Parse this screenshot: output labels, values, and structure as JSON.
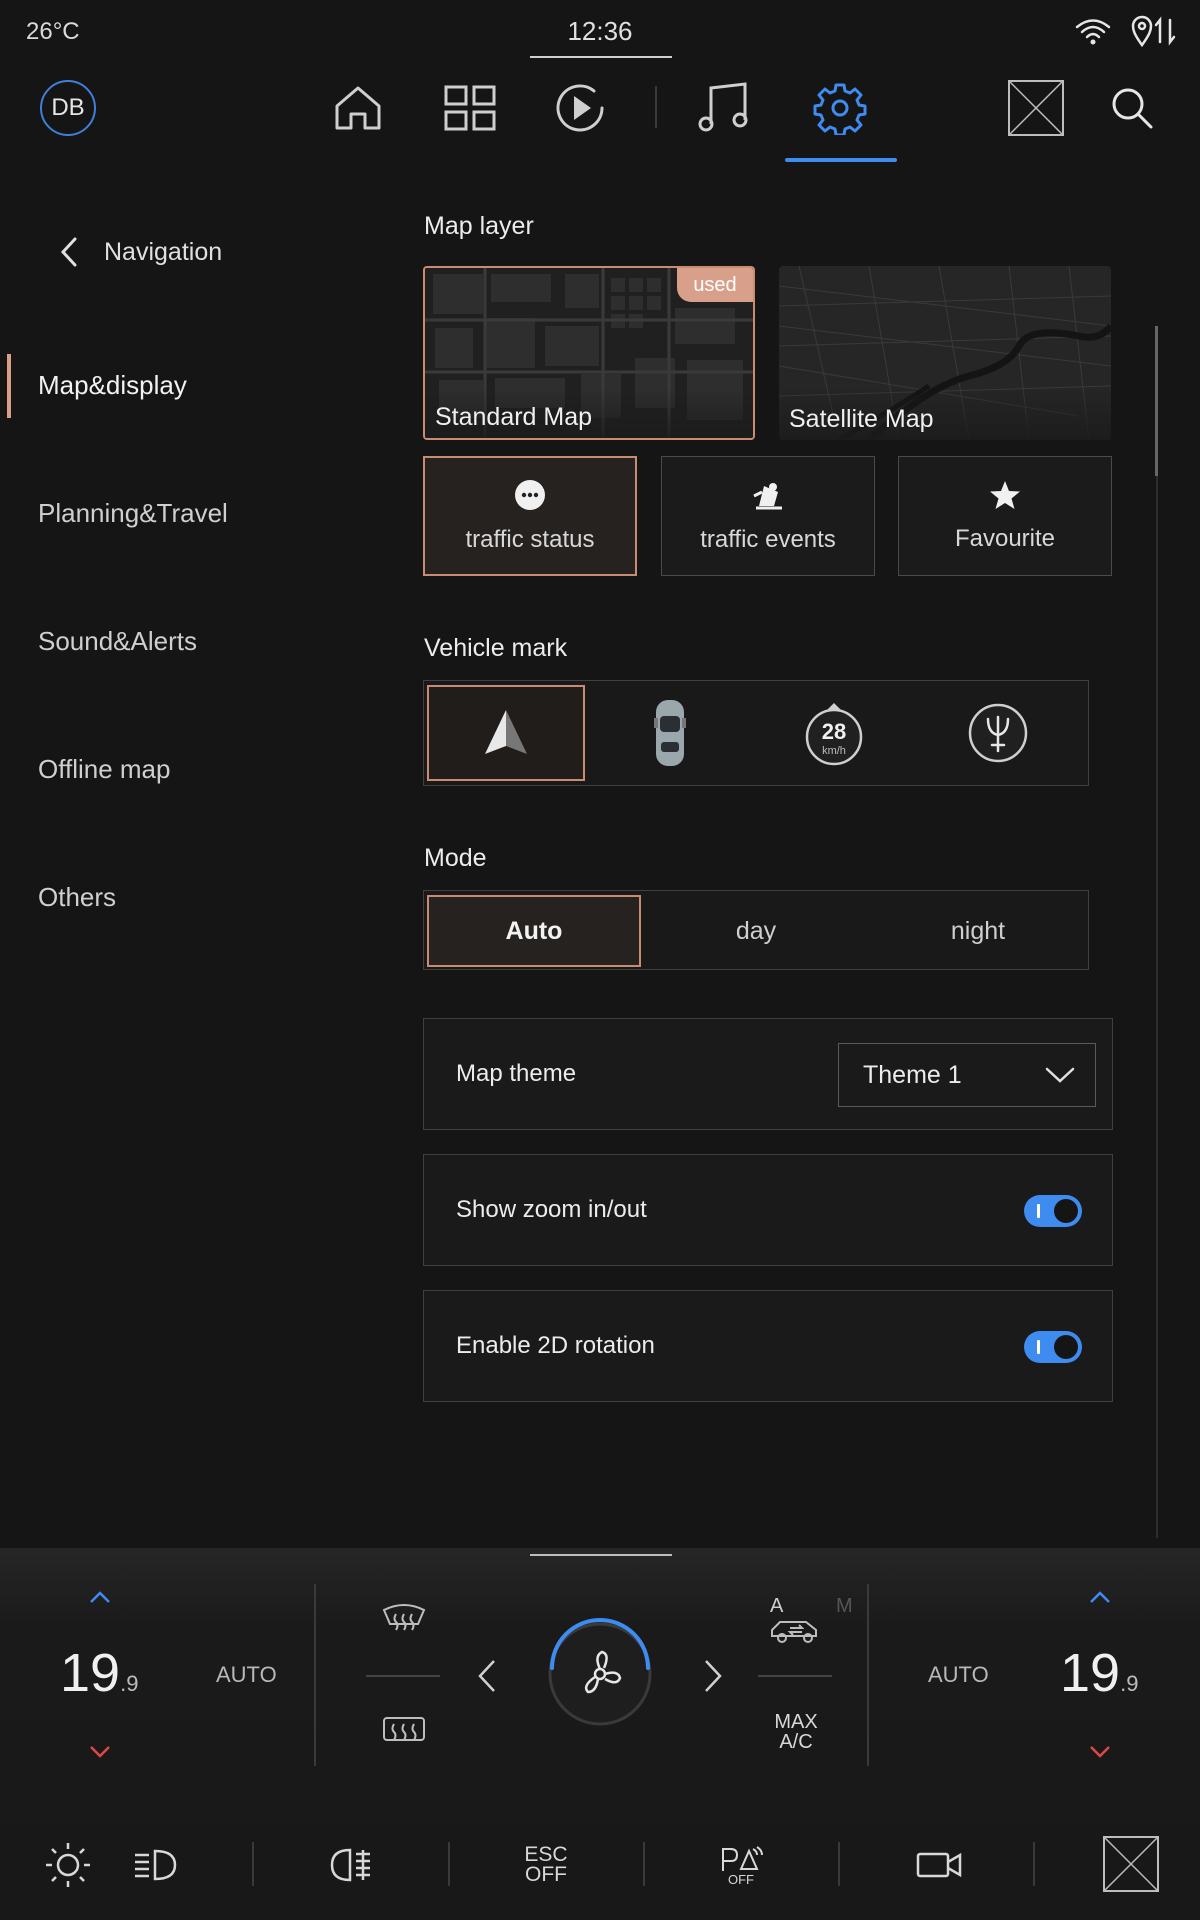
{
  "status": {
    "temperature": "26°C",
    "time": "12:36"
  },
  "user": {
    "initials": "DB"
  },
  "sidebar": {
    "back_label": "Navigation",
    "items": [
      {
        "label": "Map&display",
        "active": true
      },
      {
        "label": "Planning&Travel",
        "active": false
      },
      {
        "label": "Sound&Alerts",
        "active": false
      },
      {
        "label": "Offline map",
        "active": false
      },
      {
        "label": "Others",
        "active": false
      }
    ]
  },
  "map_layer": {
    "title": "Map layer",
    "cards": [
      {
        "label": "Standard Map",
        "badge": "used",
        "selected": true
      },
      {
        "label": "Satellite Map",
        "selected": false
      }
    ],
    "options": [
      {
        "label": "traffic status",
        "icon": "chat-bubble-icon",
        "active": true
      },
      {
        "label": "traffic events",
        "icon": "traffic-event-icon",
        "active": false
      },
      {
        "label": "Favourite",
        "icon": "star-icon",
        "active": false
      }
    ]
  },
  "vehicle_mark": {
    "title": "Vehicle mark",
    "speed_value": "28",
    "speed_unit": "km/h"
  },
  "mode": {
    "title": "Mode",
    "options": [
      "Auto",
      "day",
      "night"
    ],
    "selected": "Auto"
  },
  "map_theme": {
    "label": "Map theme",
    "value": "Theme 1"
  },
  "toggles": [
    {
      "label": "Show zoom in/out",
      "on": true
    },
    {
      "label": "Enable 2D rotation",
      "on": true
    }
  ],
  "climate": {
    "left_temp": "19",
    "left_temp_decimal": ".9",
    "right_temp": "19",
    "right_temp_decimal": ".9",
    "left_auto": "AUTO",
    "right_auto": "AUTO",
    "recirc_a": "A",
    "recirc_m": "M",
    "max_ac_line1": "MAX",
    "max_ac_line2": "A/C"
  },
  "bottom_bar": {
    "esc_line1": "ESC",
    "esc_line2": "OFF",
    "park_off": "OFF"
  },
  "colors": {
    "accent_blue": "#3f8cf0",
    "accent_copper": "#c98c73",
    "badge": "#d8a08a",
    "background": "#151515"
  }
}
